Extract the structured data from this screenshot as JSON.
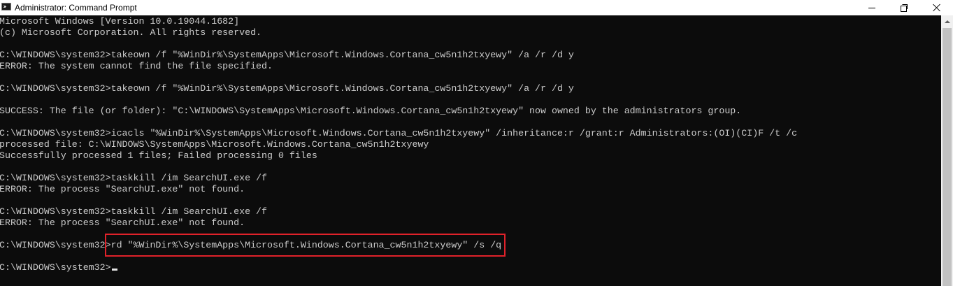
{
  "window": {
    "title": "Administrator: Command Prompt"
  },
  "console": {
    "lines": [
      "Microsoft Windows [Version 10.0.19044.1682]",
      "(c) Microsoft Corporation. All rights reserved.",
      "",
      "C:\\WINDOWS\\system32>takeown /f \"%WinDir%\\SystemApps\\Microsoft.Windows.Cortana_cw5n1h2txyewy\" /a /r /d y",
      "ERROR: The system cannot find the file specified.",
      "",
      "C:\\WINDOWS\\system32>takeown /f \"%WinDir%\\SystemApps\\Microsoft.Windows.Cortana_cw5n1h2txyewy\" /a /r /d y",
      "",
      "SUCCESS: The file (or folder): \"C:\\WINDOWS\\SystemApps\\Microsoft.Windows.Cortana_cw5n1h2txyewy\" now owned by the administrators group.",
      "",
      "C:\\WINDOWS\\system32>icacls \"%WinDir%\\SystemApps\\Microsoft.Windows.Cortana_cw5n1h2txyewy\" /inheritance:r /grant:r Administrators:(OI)(CI)F /t /c",
      "processed file: C:\\WINDOWS\\SystemApps\\Microsoft.Windows.Cortana_cw5n1h2txyewy",
      "Successfully processed 1 files; Failed processing 0 files",
      "",
      "C:\\WINDOWS\\system32>taskkill /im SearchUI.exe /f",
      "ERROR: The process \"SearchUI.exe\" not found.",
      "",
      "C:\\WINDOWS\\system32>taskkill /im SearchUI.exe /f",
      "ERROR: The process \"SearchUI.exe\" not found.",
      "",
      "C:\\WINDOWS\\system32>rd \"%WinDir%\\SystemApps\\Microsoft.Windows.Cortana_cw5n1h2txyewy\" /s /q",
      "",
      "C:\\WINDOWS\\system32>"
    ]
  },
  "icons": {
    "app": "command-prompt-icon",
    "minimize": "minimize-icon",
    "maximize": "restore-icon",
    "close": "close-icon",
    "scroll_up": "scroll-up-arrow-icon"
  },
  "colors": {
    "console_background": "#0c0c0c",
    "console_text": "#cccccc",
    "titlebar_background": "#ffffff",
    "highlight_border": "#e0222a"
  }
}
